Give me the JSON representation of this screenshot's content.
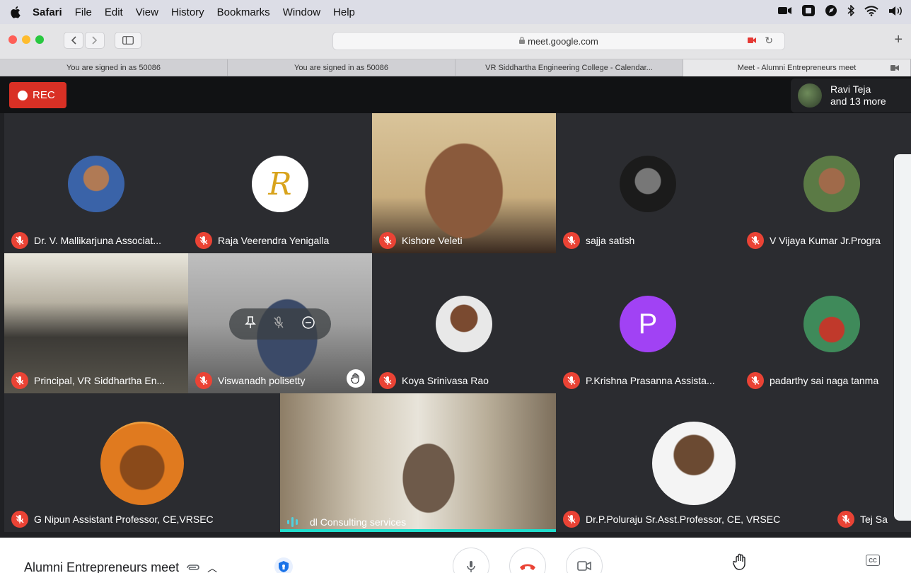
{
  "menubar": {
    "app": "Safari",
    "items": [
      "File",
      "Edit",
      "View",
      "History",
      "Bookmarks",
      "Window",
      "Help"
    ]
  },
  "browser": {
    "url": "meet.google.com",
    "tabs": [
      {
        "label": "You are signed in as 50086",
        "active": false
      },
      {
        "label": "You are signed in as 50086",
        "active": false
      },
      {
        "label": "VR Siddhartha Engineering College - Calendar...",
        "active": false
      },
      {
        "label": "Meet - Alumni Entrepreneurs meet",
        "active": true
      }
    ]
  },
  "meet": {
    "rec_label": "REC",
    "participants_name": "Ravi Teja",
    "participants_more": "and 13 more",
    "tiles": [
      {
        "name": "Dr. V. Mallikarjuna Associat...",
        "muted": true
      },
      {
        "name": "Raja Veerendra Yenigalla",
        "muted": true,
        "avatar_letter": "R"
      },
      {
        "name": "Kishore Veleti",
        "muted": true
      },
      {
        "name": "sajja satish",
        "muted": true
      },
      {
        "name": "V Vijaya Kumar Jr.Progra",
        "muted": true
      },
      {
        "name": "Principal, VR Siddhartha En...",
        "muted": true
      },
      {
        "name": "Viswanadh polisetty",
        "muted": true,
        "hand_raised": true
      },
      {
        "name": "Koya Srinivasa Rao",
        "muted": true
      },
      {
        "name": "P.Krishna Prasanna Assista...",
        "muted": true,
        "avatar_letter": "P"
      },
      {
        "name": "padarthy sai naga tanma",
        "muted": true
      },
      {
        "name": "G Nipun Assistant Professor, CE,VRSEC",
        "muted": true
      },
      {
        "name": "dl Consulting services",
        "muted": false,
        "speaking": true
      },
      {
        "name": "Dr.P.Poluraju Sr.Asst.Professor, CE, VRSEC",
        "muted": true
      },
      {
        "name": "Tej Sa",
        "muted": true
      }
    ],
    "meeting_title": "Alumni Entrepreneurs meet"
  },
  "colors": {
    "rec_red": "#d93025",
    "mic_off_red": "#ea4335",
    "speaking_cyan": "#1fdccb",
    "avatar_purple": "#a142f4"
  }
}
